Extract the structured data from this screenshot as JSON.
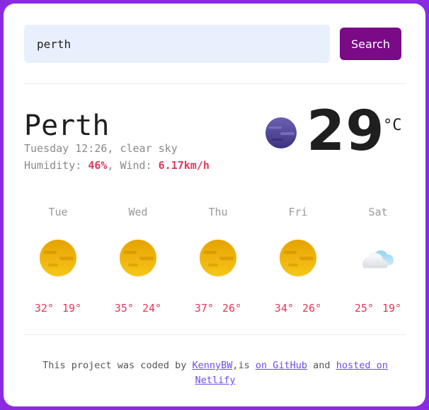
{
  "search": {
    "value": "perth",
    "button_label": "Search"
  },
  "current": {
    "city": "Perth",
    "day_time": "Tuesday 12:26",
    "description": "clear sky",
    "humidity_label": "Humidity:",
    "humidity": "46%",
    "wind_label": "Wind:",
    "wind": "6.17km/h",
    "temperature": "29",
    "unit": "°C",
    "icon": "night-clear-icon"
  },
  "forecast": [
    {
      "day": "Tue",
      "max": "32°",
      "min": "19°",
      "icon": "sun-icon"
    },
    {
      "day": "Wed",
      "max": "35°",
      "min": "24°",
      "icon": "sun-icon"
    },
    {
      "day": "Thu",
      "max": "37°",
      "min": "26°",
      "icon": "sun-icon"
    },
    {
      "day": "Fri",
      "max": "34°",
      "min": "26°",
      "icon": "sun-icon"
    },
    {
      "day": "Sat",
      "max": "25°",
      "min": "19°",
      "icon": "cloud-icon"
    }
  ],
  "footer": {
    "text_before": "This project was coded by ",
    "author_link": "KennyBW",
    "text_middle": ",is ",
    "github_link": "on GitHub",
    "text_and": " and ",
    "hosted_link": "hosted on Netlify"
  },
  "colors": {
    "background": "#8a2be2",
    "accent_button": "#7a0a86",
    "highlight": "#e0385a",
    "link": "#6a4cf0"
  }
}
